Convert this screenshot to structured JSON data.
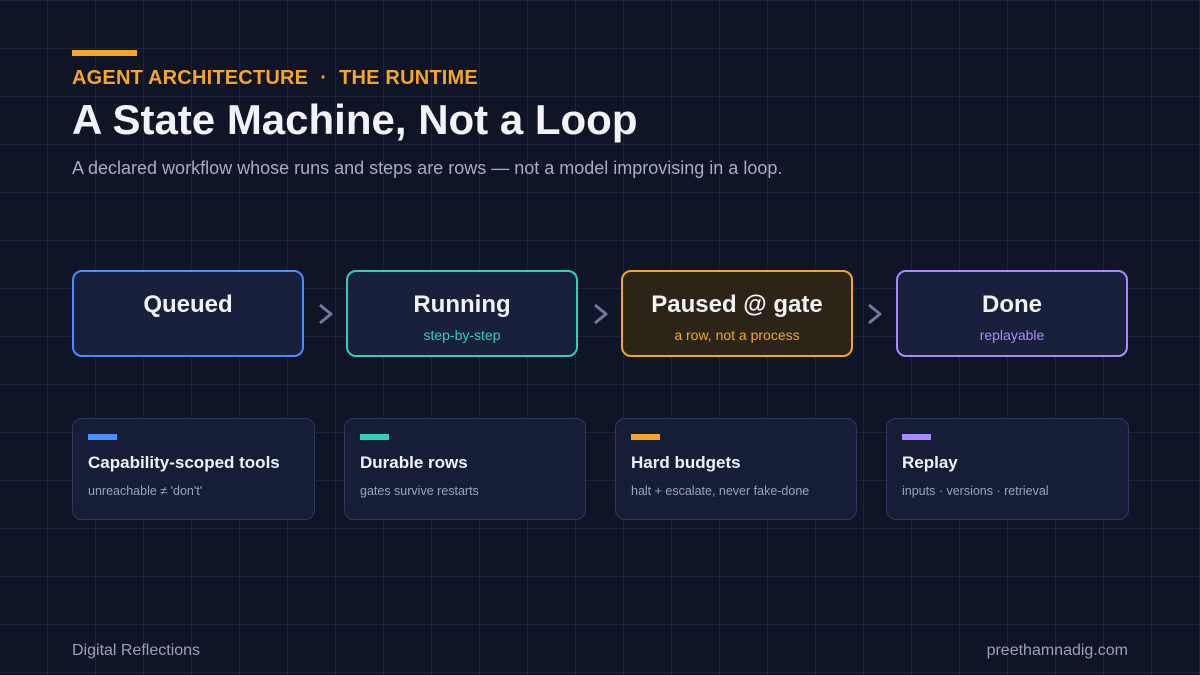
{
  "header": {
    "eyebrow_left": "AGENT ARCHITECTURE",
    "eyebrow_sep": "·",
    "eyebrow_right": "THE RUNTIME",
    "title": "A State Machine, Not a Loop",
    "subtitle": "A declared workflow whose runs and steps are rows — not a model improvising in a loop."
  },
  "colors": {
    "accent": "#f5a623",
    "blue": "#4a8dff",
    "teal": "#2fd1b2",
    "orange": "#f5a623",
    "purple": "#a98bff",
    "background": "#0f1427"
  },
  "states": [
    {
      "name": "Queued",
      "sub": "",
      "color": "#4a8dff"
    },
    {
      "name": "Running",
      "sub": "step-by-step",
      "color": "#2fd1b2"
    },
    {
      "name": "Paused @ gate",
      "sub": "a row, not a process",
      "color": "#f5a623"
    },
    {
      "name": "Done",
      "sub": "replayable",
      "color": "#a98bff"
    }
  ],
  "cards": [
    {
      "title": "Capability-scoped tools",
      "text": "unreachable ≠ 'don't'",
      "color": "#4a8dff"
    },
    {
      "title": "Durable rows",
      "text": "gates survive restarts",
      "color": "#2fd1b2"
    },
    {
      "title": "Hard budgets",
      "text": "halt + escalate, never fake-done",
      "color": "#f5a623"
    },
    {
      "title": "Replay",
      "text": "inputs · versions · retrieval",
      "color": "#a98bff"
    }
  ],
  "footer": {
    "left": "Digital Reflections",
    "right": "preethamnadig.com"
  }
}
